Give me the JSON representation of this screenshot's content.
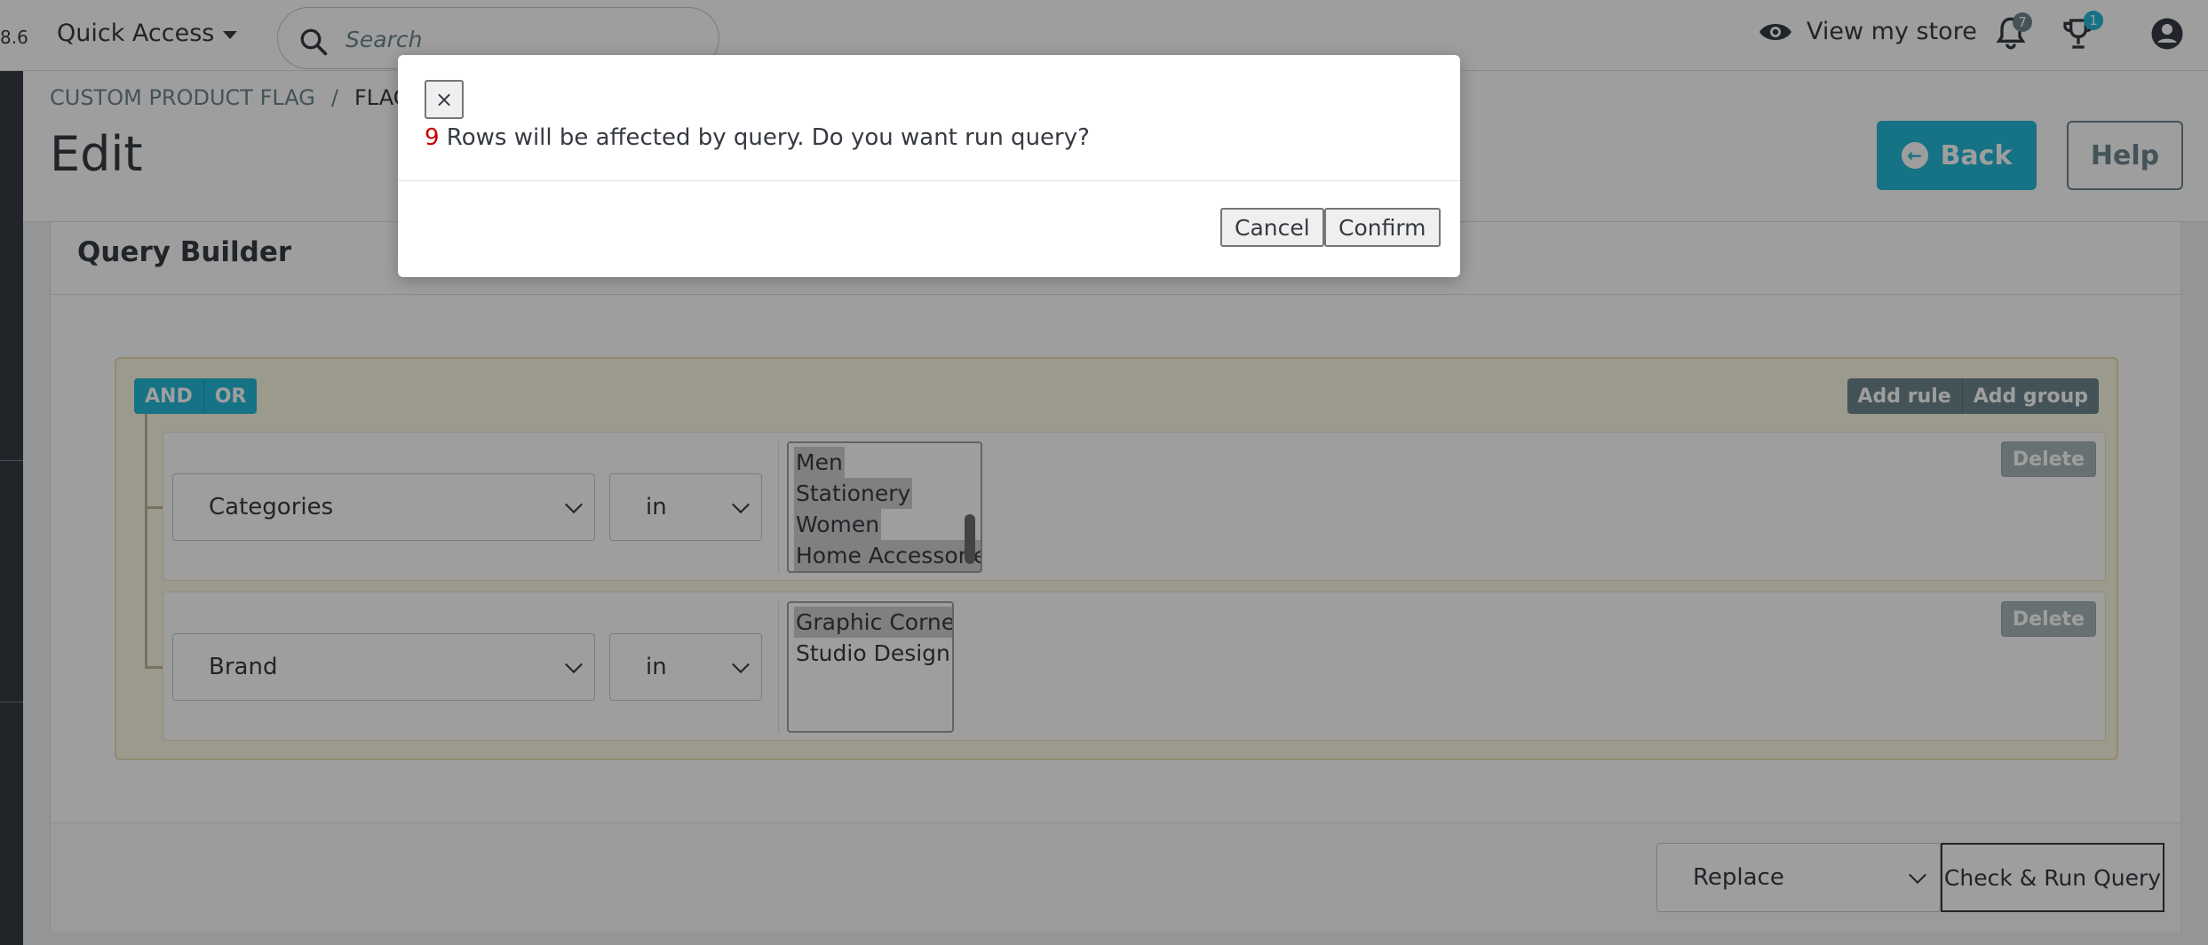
{
  "header": {
    "version": "8.6",
    "quick_access": "Quick Access",
    "search_placeholder": "Search",
    "view_store": "View my store",
    "notifications_count": "7",
    "orders_count": "1"
  },
  "breadcrumb": {
    "parent": "CUSTOM PRODUCT FLAG",
    "separator": "/",
    "current": "FLAG"
  },
  "page": {
    "title": "Edit",
    "back_label": "Back",
    "help_label": "Help"
  },
  "query_builder": {
    "title": "Query Builder",
    "conditions": [
      "AND",
      "OR"
    ],
    "add_rule": "Add rule",
    "add_group": "Add group",
    "rules": [
      {
        "field": "Categories",
        "operator": "in",
        "options": [
          "Men",
          "Stationery",
          "Women",
          "Home Accessories"
        ],
        "delete_label": "Delete"
      },
      {
        "field": "Brand",
        "operator": "in",
        "options": [
          "Graphic Corner",
          "Studio Design"
        ],
        "delete_label": "Delete"
      }
    ],
    "mode": "Replace",
    "run_label": "Check & Run Query"
  },
  "modal": {
    "close": "×",
    "count": "9",
    "message": " Rows will be affected by query. Do you want run query?",
    "cancel": "Cancel",
    "confirm": "Confirm"
  }
}
